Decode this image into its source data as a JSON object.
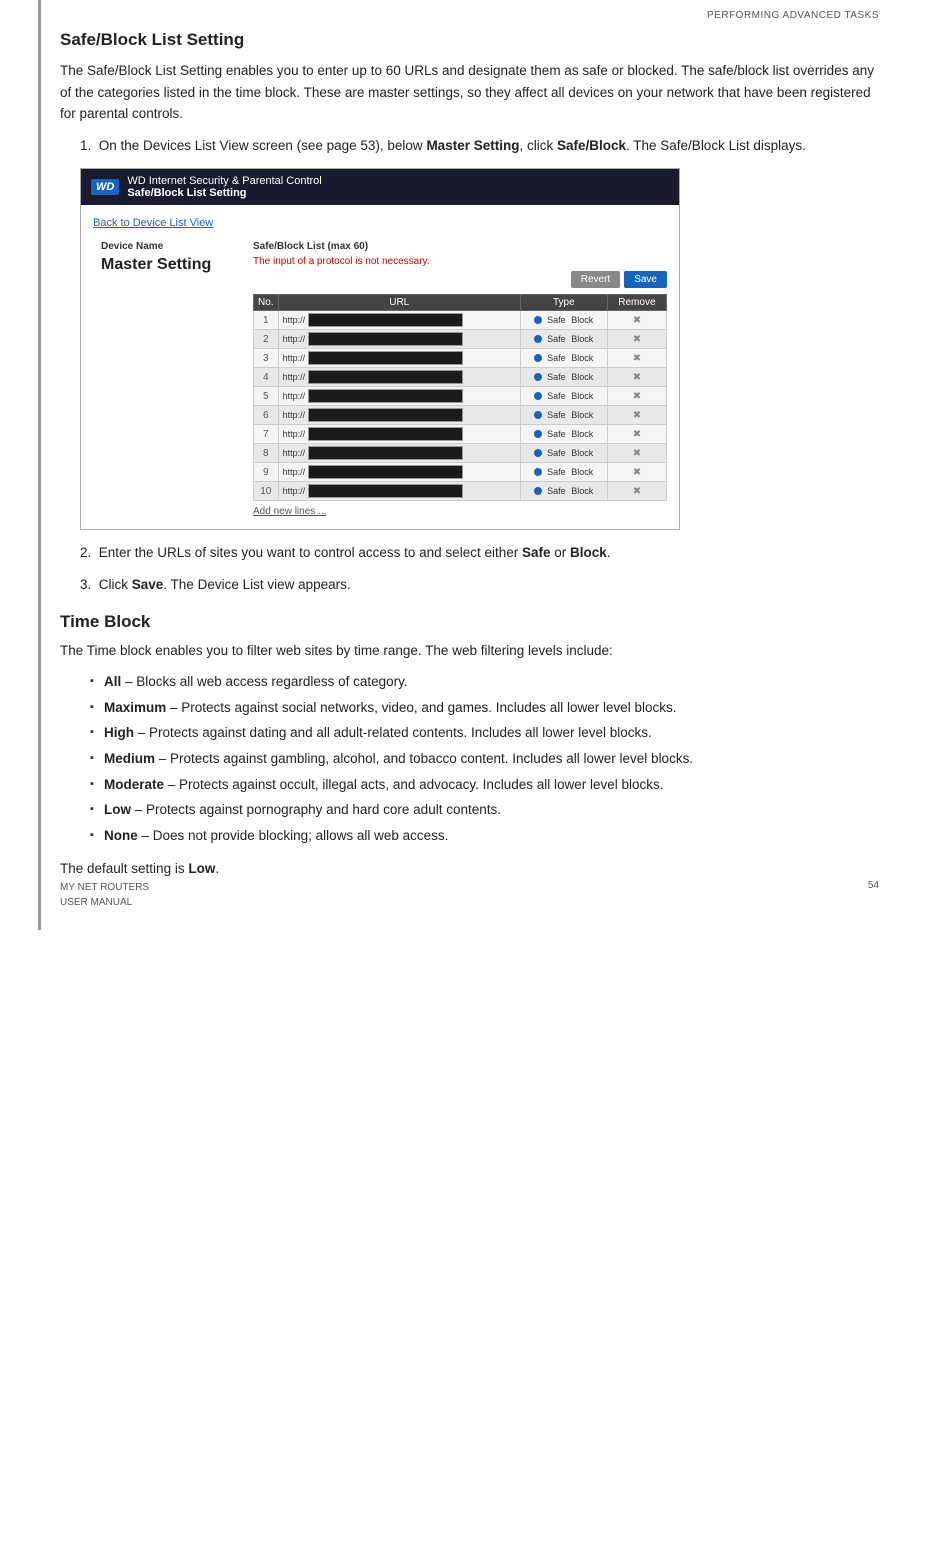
{
  "header": {
    "top_label": "PERFORMING ADVANCED TASKS"
  },
  "section1": {
    "title": "Safe/Block List Setting",
    "intro": "The Safe/Block List Setting enables you to enter up to 60 URLs and designate them as safe or blocked. The safe/block list overrides any of the categories listed in the time block. These are master settings, so they affect all devices on your network that have been registered for parental controls.",
    "step1_prefix": "1.  On the Devices List View screen (see page 53), below ",
    "step1_bold1": "Master Setting",
    "step1_mid": ", click ",
    "step1_bold2": "Safe/Block",
    "step1_suffix": ". The Safe/Block List displays.",
    "step2": "2.  Enter the URLs of sites you want to control access to and select either ",
    "step2_bold1": "Safe",
    "step2_mid": " or ",
    "step2_bold2": "Block",
    "step2_suffix": ".",
    "step3_prefix": "3.  Click ",
    "step3_bold": "Save",
    "step3_suffix": ". The Device List view appears."
  },
  "screenshot": {
    "app_name": "WD Internet Security & Parental Control",
    "app_subtitle": "Safe/Block List Setting",
    "back_link": "Back to Device List View",
    "device_name_label": "Device Name",
    "device_name_value": "Master Setting",
    "safe_block_label": "Safe/Block List (max 60)",
    "error_msg": "The input of a protocol is not necessary.",
    "btn_revert": "Revert",
    "btn_save": "Save",
    "table_headers": [
      "No.",
      "URL",
      "Type",
      "Remove"
    ],
    "rows": [
      {
        "num": "1",
        "url": "http://"
      },
      {
        "num": "2",
        "url": "http://"
      },
      {
        "num": "3",
        "url": "http://"
      },
      {
        "num": "4",
        "url": "http://"
      },
      {
        "num": "5",
        "url": "http://"
      },
      {
        "num": "6",
        "url": "http://"
      },
      {
        "num": "7",
        "url": "http://"
      },
      {
        "num": "8",
        "url": "http://"
      },
      {
        "num": "9",
        "url": "http://"
      },
      {
        "num": "10",
        "url": "http://"
      }
    ],
    "add_new_link": "Add new lines ..."
  },
  "section2": {
    "title": "Time Block",
    "intro": "The Time block enables you to filter web sites by time range. The web filtering levels include:",
    "bullets": [
      {
        "bold": "All",
        "text": " – Blocks all web access regardless of category."
      },
      {
        "bold": "Maximum",
        "text": " – Protects against social networks, video, and games. Includes all lower level blocks."
      },
      {
        "bold": "High",
        "text": " – Protects against dating and all adult-related contents. Includes all lower level blocks."
      },
      {
        "bold": "Medium",
        "text": " – Protects against gambling, alcohol, and tobacco content. Includes all lower level blocks."
      },
      {
        "bold": "Moderate",
        "text": " – Protects against occult, illegal acts, and advocacy. Includes all lower level blocks."
      },
      {
        "bold": "Low",
        "text": " – Protects against pornography and hard core adult contents."
      },
      {
        "bold": "None",
        "text": " – Does not provide blocking; allows all web access."
      }
    ],
    "default_text_prefix": "The default setting is ",
    "default_bold": "Low",
    "default_suffix": "."
  },
  "footer": {
    "left_line1": "MY NET ROUTERS",
    "left_line2": "USER MANUAL",
    "right": "54"
  }
}
